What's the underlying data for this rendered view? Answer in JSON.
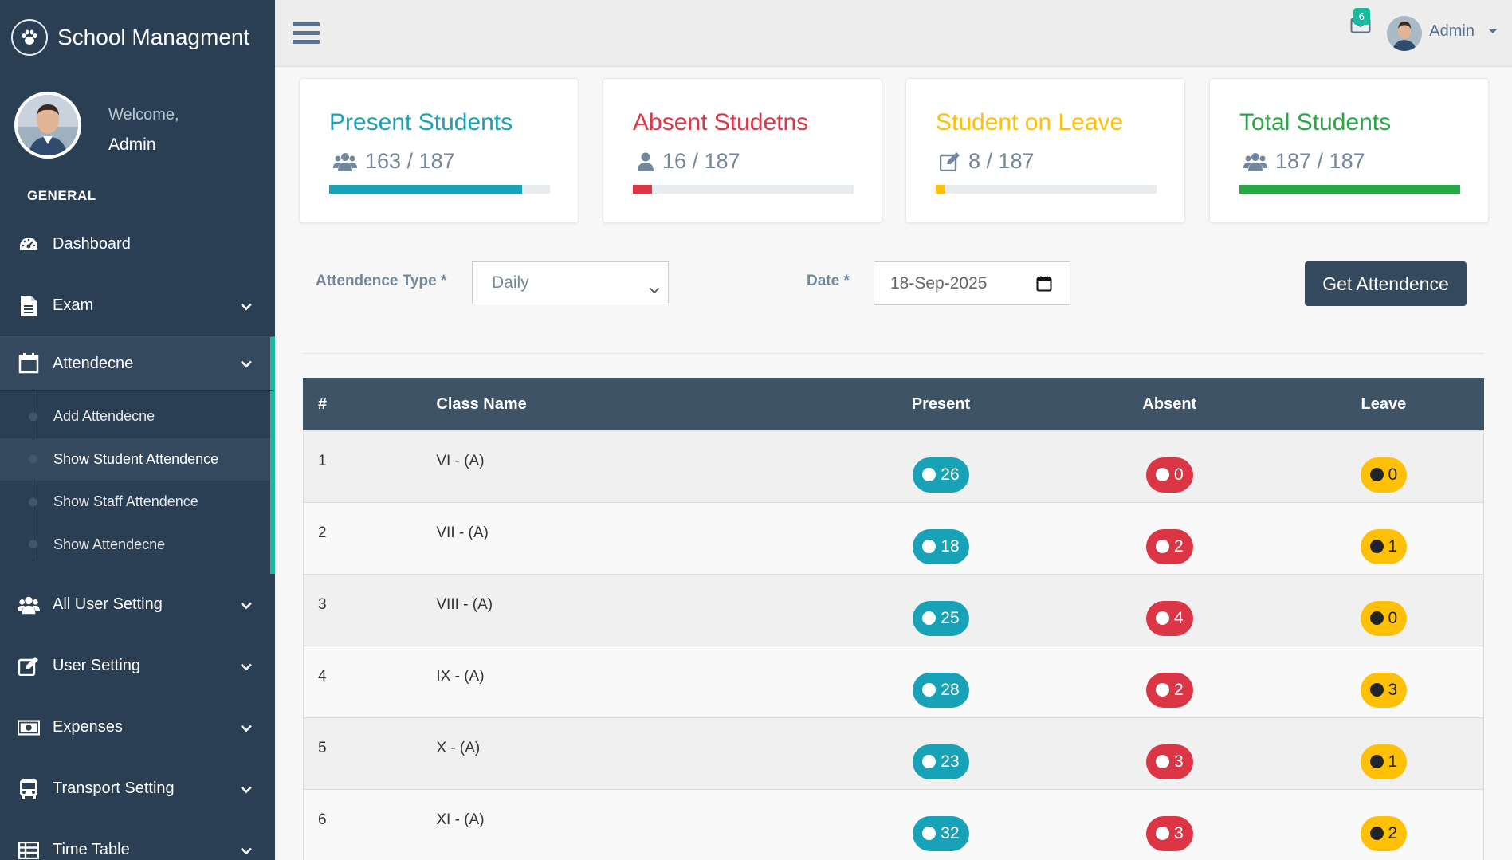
{
  "brand": {
    "title": "School Managment"
  },
  "profile": {
    "welcome": "Welcome,",
    "name": "Admin"
  },
  "sidebar": {
    "section": "GENERAL",
    "items": [
      {
        "label": "Dashboard",
        "icon": "dashboard-icon"
      },
      {
        "label": "Exam",
        "icon": "file-icon"
      },
      {
        "label": "Attendecne",
        "icon": "calendar-icon"
      },
      {
        "label": "All User Setting",
        "icon": "users-icon"
      },
      {
        "label": "User Setting",
        "icon": "edit-icon"
      },
      {
        "label": "Expenses",
        "icon": "money-icon"
      },
      {
        "label": "Transport Setting",
        "icon": "bus-icon"
      },
      {
        "label": "Time Table",
        "icon": "table-icon"
      }
    ],
    "submenu": [
      "Add Attendecne",
      "Show Student Attendence",
      "Show Staff Attendence",
      "Show Attendecne"
    ]
  },
  "topbar": {
    "mail_count": "6",
    "user": "Admin"
  },
  "cards": [
    {
      "title": "Present Students",
      "value": "163 / 187",
      "color": "#17a2b8",
      "progress": 0.872
    },
    {
      "title": "Absent Studetns",
      "value": "16 / 187",
      "color": "#dc3545",
      "progress": 0.086
    },
    {
      "title": "Student on Leave",
      "value": "8 / 187",
      "color": "#ffc107",
      "progress": 0.043
    },
    {
      "title": "Total Students",
      "value": "187 / 187",
      "color": "#28a745",
      "progress": 1.0
    }
  ],
  "filters": {
    "type_label": "Attendence Type *",
    "type_value": "Daily",
    "date_label": "Date *",
    "date_value": "18-Sep-2025",
    "button": "Get Attendence"
  },
  "table": {
    "headers": [
      "#",
      "Class Name",
      "Present",
      "Absent",
      "Leave"
    ],
    "rows": [
      {
        "num": "1",
        "class": "VI - (A)",
        "present": "26",
        "absent": "0",
        "leave": "0"
      },
      {
        "num": "2",
        "class": "VII - (A)",
        "present": "18",
        "absent": "2",
        "leave": "1"
      },
      {
        "num": "3",
        "class": "VIII - (A)",
        "present": "25",
        "absent": "4",
        "leave": "0"
      },
      {
        "num": "4",
        "class": "IX - (A)",
        "present": "28",
        "absent": "2",
        "leave": "3"
      },
      {
        "num": "5",
        "class": "X - (A)",
        "present": "23",
        "absent": "3",
        "leave": "1"
      },
      {
        "num": "6",
        "class": "XI - (A)",
        "present": "32",
        "absent": "3",
        "leave": "2"
      }
    ]
  }
}
